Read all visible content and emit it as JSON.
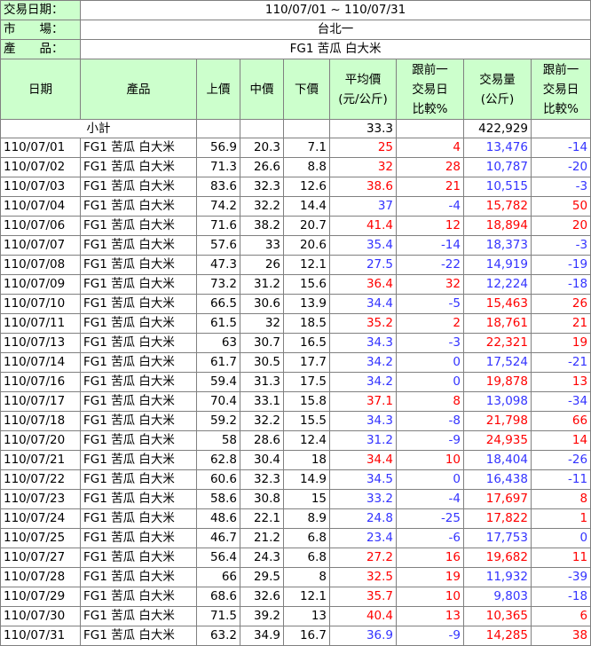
{
  "info": {
    "date_label": "交易日期：",
    "date_value": "110/07/01 ~ 110/07/31",
    "market_label": "市　　場：",
    "market_value": "台北一",
    "product_label": "產　　品：",
    "product_value": "FG1 苦瓜 白大米"
  },
  "columns": {
    "date": "日期",
    "product": "產品",
    "high": "上價",
    "mid": "中價",
    "low": "下價",
    "avg": [
      "平均價",
      "(元/公斤)"
    ],
    "avg_change": [
      "跟前一",
      "交易日",
      "比較%"
    ],
    "volume": [
      "交易量",
      "(公斤)"
    ],
    "vol_change": [
      "跟前一",
      "交易日",
      "比較%"
    ]
  },
  "subtotal": {
    "label": "小計",
    "avg": "33.3",
    "volume": "422,929"
  },
  "colors": {
    "header_bg": "#ccffcc",
    "up": "#ff0000",
    "down": "#3333ff"
  },
  "rows": [
    {
      "date": "110/07/01",
      "product": "FG1 苦瓜 白大米",
      "high": "56.9",
      "mid": "20.3",
      "low": "7.1",
      "avg": "25",
      "avg_change": "4",
      "volume": "13,476",
      "vol_change": "-14"
    },
    {
      "date": "110/07/02",
      "product": "FG1 苦瓜 白大米",
      "high": "71.3",
      "mid": "26.6",
      "low": "8.8",
      "avg": "32",
      "avg_change": "28",
      "volume": "10,787",
      "vol_change": "-20"
    },
    {
      "date": "110/07/03",
      "product": "FG1 苦瓜 白大米",
      "high": "83.6",
      "mid": "32.3",
      "low": "12.6",
      "avg": "38.6",
      "avg_change": "21",
      "volume": "10,515",
      "vol_change": "-3"
    },
    {
      "date": "110/07/04",
      "product": "FG1 苦瓜 白大米",
      "high": "74.2",
      "mid": "32.2",
      "low": "14.4",
      "avg": "37",
      "avg_change": "-4",
      "volume": "15,782",
      "vol_change": "50"
    },
    {
      "date": "110/07/06",
      "product": "FG1 苦瓜 白大米",
      "high": "71.6",
      "mid": "38.2",
      "low": "20.7",
      "avg": "41.4",
      "avg_change": "12",
      "volume": "18,894",
      "vol_change": "20"
    },
    {
      "date": "110/07/07",
      "product": "FG1 苦瓜 白大米",
      "high": "57.6",
      "mid": "33",
      "low": "20.6",
      "avg": "35.4",
      "avg_change": "-14",
      "volume": "18,373",
      "vol_change": "-3"
    },
    {
      "date": "110/07/08",
      "product": "FG1 苦瓜 白大米",
      "high": "47.3",
      "mid": "26",
      "low": "12.1",
      "avg": "27.5",
      "avg_change": "-22",
      "volume": "14,919",
      "vol_change": "-19"
    },
    {
      "date": "110/07/09",
      "product": "FG1 苦瓜 白大米",
      "high": "73.2",
      "mid": "31.2",
      "low": "15.6",
      "avg": "36.4",
      "avg_change": "32",
      "volume": "12,224",
      "vol_change": "-18"
    },
    {
      "date": "110/07/10",
      "product": "FG1 苦瓜 白大米",
      "high": "66.5",
      "mid": "30.6",
      "low": "13.9",
      "avg": "34.4",
      "avg_change": "-5",
      "volume": "15,463",
      "vol_change": "26"
    },
    {
      "date": "110/07/11",
      "product": "FG1 苦瓜 白大米",
      "high": "61.5",
      "mid": "32",
      "low": "18.5",
      "avg": "35.2",
      "avg_change": "2",
      "volume": "18,761",
      "vol_change": "21"
    },
    {
      "date": "110/07/13",
      "product": "FG1 苦瓜 白大米",
      "high": "63",
      "mid": "30.7",
      "low": "16.5",
      "avg": "34.3",
      "avg_change": "-3",
      "volume": "22,321",
      "vol_change": "19"
    },
    {
      "date": "110/07/14",
      "product": "FG1 苦瓜 白大米",
      "high": "61.7",
      "mid": "30.5",
      "low": "17.7",
      "avg": "34.2",
      "avg_change": "0",
      "volume": "17,524",
      "vol_change": "-21"
    },
    {
      "date": "110/07/16",
      "product": "FG1 苦瓜 白大米",
      "high": "59.4",
      "mid": "31.3",
      "low": "17.5",
      "avg": "34.2",
      "avg_change": "0",
      "volume": "19,878",
      "vol_change": "13"
    },
    {
      "date": "110/07/17",
      "product": "FG1 苦瓜 白大米",
      "high": "70.4",
      "mid": "33.1",
      "low": "15.8",
      "avg": "37.1",
      "avg_change": "8",
      "volume": "13,098",
      "vol_change": "-34"
    },
    {
      "date": "110/07/18",
      "product": "FG1 苦瓜 白大米",
      "high": "59.2",
      "mid": "32.2",
      "low": "15.5",
      "avg": "34.3",
      "avg_change": "-8",
      "volume": "21,798",
      "vol_change": "66"
    },
    {
      "date": "110/07/20",
      "product": "FG1 苦瓜 白大米",
      "high": "58",
      "mid": "28.6",
      "low": "12.4",
      "avg": "31.2",
      "avg_change": "-9",
      "volume": "24,935",
      "vol_change": "14"
    },
    {
      "date": "110/07/21",
      "product": "FG1 苦瓜 白大米",
      "high": "62.8",
      "mid": "30.4",
      "low": "18",
      "avg": "34.4",
      "avg_change": "10",
      "volume": "18,404",
      "vol_change": "-26"
    },
    {
      "date": "110/07/22",
      "product": "FG1 苦瓜 白大米",
      "high": "60.6",
      "mid": "32.3",
      "low": "14.9",
      "avg": "34.5",
      "avg_change": "0",
      "volume": "16,438",
      "vol_change": "-11"
    },
    {
      "date": "110/07/23",
      "product": "FG1 苦瓜 白大米",
      "high": "58.6",
      "mid": "30.8",
      "low": "15",
      "avg": "33.2",
      "avg_change": "-4",
      "volume": "17,697",
      "vol_change": "8"
    },
    {
      "date": "110/07/24",
      "product": "FG1 苦瓜 白大米",
      "high": "48.6",
      "mid": "22.1",
      "low": "8.9",
      "avg": "24.8",
      "avg_change": "-25",
      "volume": "17,822",
      "vol_change": "1"
    },
    {
      "date": "110/07/25",
      "product": "FG1 苦瓜 白大米",
      "high": "46.7",
      "mid": "21.2",
      "low": "6.8",
      "avg": "23.4",
      "avg_change": "-6",
      "volume": "17,753",
      "vol_change": "0"
    },
    {
      "date": "110/07/27",
      "product": "FG1 苦瓜 白大米",
      "high": "56.4",
      "mid": "24.3",
      "low": "6.8",
      "avg": "27.2",
      "avg_change": "16",
      "volume": "19,682",
      "vol_change": "11"
    },
    {
      "date": "110/07/28",
      "product": "FG1 苦瓜 白大米",
      "high": "66",
      "mid": "29.5",
      "low": "8",
      "avg": "32.5",
      "avg_change": "19",
      "volume": "11,932",
      "vol_change": "-39"
    },
    {
      "date": "110/07/29",
      "product": "FG1 苦瓜 白大米",
      "high": "68.6",
      "mid": "32.6",
      "low": "12.1",
      "avg": "35.7",
      "avg_change": "10",
      "volume": "9,803",
      "vol_change": "-18"
    },
    {
      "date": "110/07/30",
      "product": "FG1 苦瓜 白大米",
      "high": "71.5",
      "mid": "39.2",
      "low": "13",
      "avg": "40.4",
      "avg_change": "13",
      "volume": "10,365",
      "vol_change": "6"
    },
    {
      "date": "110/07/31",
      "product": "FG1 苦瓜 白大米",
      "high": "63.2",
      "mid": "34.9",
      "low": "16.7",
      "avg": "36.9",
      "avg_change": "-9",
      "volume": "14,285",
      "vol_change": "38"
    }
  ]
}
